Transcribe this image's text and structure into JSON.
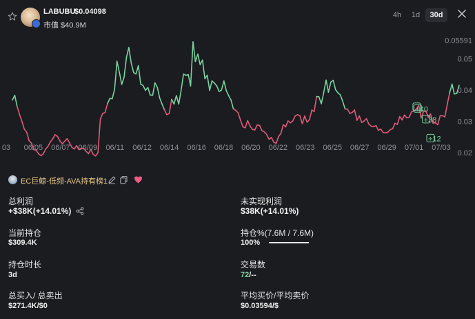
{
  "header": {
    "ticker": "LABUBU",
    "price": "$0.04098",
    "market_cap": "市值 $40.9M",
    "timeframes": [
      "4h",
      "1d",
      "30d"
    ],
    "active_timeframe": "30d"
  },
  "chart_data": {
    "type": "line",
    "x_ticks": [
      "03",
      "06/05",
      "06/07",
      "06/09",
      "06/11",
      "06/12",
      "06/14",
      "06/16",
      "06/18",
      "06/20",
      "06/22",
      "06/23",
      "06/25",
      "06/27",
      "06/29",
      "07/01",
      "07/03"
    ],
    "y_ticks": [
      "0.05591",
      "0.05",
      "0.04",
      "0.03",
      "0.02"
    ],
    "ylim": [
      0.0182,
      0.0578
    ],
    "series_color_up": "#7ad3a0",
    "series_color_down": "#e05b7a",
    "y": [
      0.0368,
      0.0383,
      0.0347,
      0.0322,
      0.03,
      0.0275,
      0.0265,
      0.0238,
      0.023,
      0.0209,
      0.0207,
      0.0196,
      0.019,
      0.0196,
      0.0211,
      0.022,
      0.0234,
      0.0244,
      0.0257,
      0.0251,
      0.0237,
      0.0228,
      0.0236,
      0.0244,
      0.0232,
      0.0217,
      0.0211,
      0.0222,
      0.0209,
      0.0214,
      0.0213,
      0.0204,
      0.0196,
      0.021,
      0.0194,
      0.0189,
      0.0199,
      0.0306,
      0.0325,
      0.0328,
      0.0356,
      0.0373,
      0.0372,
      0.0402,
      0.0492,
      0.0457,
      0.0418,
      0.0441,
      0.0504,
      0.0536,
      0.0487,
      0.0456,
      0.0451,
      0.0478,
      0.0419,
      0.0414,
      0.0399,
      0.0408,
      0.0384,
      0.0383,
      0.0423,
      0.0408,
      0.0374,
      0.0355,
      0.0336,
      0.0321,
      0.0325,
      0.037,
      0.0355,
      0.0382,
      0.0355,
      0.0399,
      0.0451,
      0.0447,
      0.0449,
      0.0413,
      0.0554,
      0.0491,
      0.0515,
      0.0481,
      0.0496,
      0.0436,
      0.0447,
      0.0399,
      0.0429,
      0.0422,
      0.0413,
      0.0395,
      0.04,
      0.0429,
      0.0398,
      0.0382,
      0.0368,
      0.0339,
      0.0335,
      0.0327,
      0.0303,
      0.0282,
      0.0279,
      0.0302,
      0.0285,
      0.0274,
      0.0272,
      0.0288,
      0.0287,
      0.027,
      0.0266,
      0.0258,
      0.0242,
      0.0248,
      0.0233,
      0.0229,
      0.0251,
      0.0261,
      0.0289,
      0.0282,
      0.0301,
      0.0295,
      0.0301,
      0.0317,
      0.0321,
      0.0317,
      0.0292,
      0.0317,
      0.0297,
      0.0305,
      0.0336,
      0.0331,
      0.0379,
      0.0378,
      0.0356,
      0.0391,
      0.0432,
      0.0393,
      0.0425,
      0.0431,
      0.0401,
      0.0391,
      0.0384,
      0.0364,
      0.0339,
      0.0339,
      0.0325,
      0.0328,
      0.0336,
      0.0303,
      0.0317,
      0.0296,
      0.0301,
      0.0308,
      0.0291,
      0.0284,
      0.0283,
      0.0286,
      0.0271,
      0.0275,
      0.0264,
      0.0263,
      0.0265,
      0.0273,
      0.0276,
      0.0293,
      0.029,
      0.0315,
      0.0304,
      0.032,
      0.0311,
      0.0313,
      0.0331,
      0.0333,
      0.0339,
      0.035,
      0.031,
      0.0331,
      0.0333,
      0.0313,
      0.0323,
      0.0294,
      0.0295,
      0.0289,
      0.0317,
      0.0318,
      0.0314,
      0.0354,
      0.0391,
      0.0419,
      0.0387,
      0.0389,
      0.0415
    ],
    "markers": [
      {
        "label": "",
        "index": 172
      },
      {
        "label": "+40",
        "index": 173
      },
      {
        "label": "+38",
        "index": 176
      },
      {
        "label": "+12",
        "index": 179
      }
    ]
  },
  "wallet": {
    "name": "EC巨鲸-低频-AVA持有榜1"
  },
  "stats": {
    "total_profit_label": "总利润",
    "total_profit_value": "+$38K(+14.01%)",
    "unrealized_label": "未实现利润",
    "unrealized_value": "$38K(+14.01%)",
    "position_label": "当前持仓",
    "position_value": "$309.4K",
    "holding_pct_label": "持仓%(7.6M / 7.6M)",
    "holding_pct_value": "100%",
    "holding_fraction": 1.0,
    "duration_label": "持仓时长",
    "duration_value": "3d",
    "trades_label": "交易数",
    "trades_buy": "72",
    "trades_sell": "/--",
    "buy_sell_label": "总买入/ 总卖出",
    "buy_sell_value": "$271.4K/$0",
    "avg_price_label": "平均买价/平均卖价",
    "avg_price_value": "$0.03594/$"
  },
  "colors": {
    "accent_green": "#7ad3a0",
    "accent_red": "#e05b7a",
    "background": "#1b1c20"
  }
}
